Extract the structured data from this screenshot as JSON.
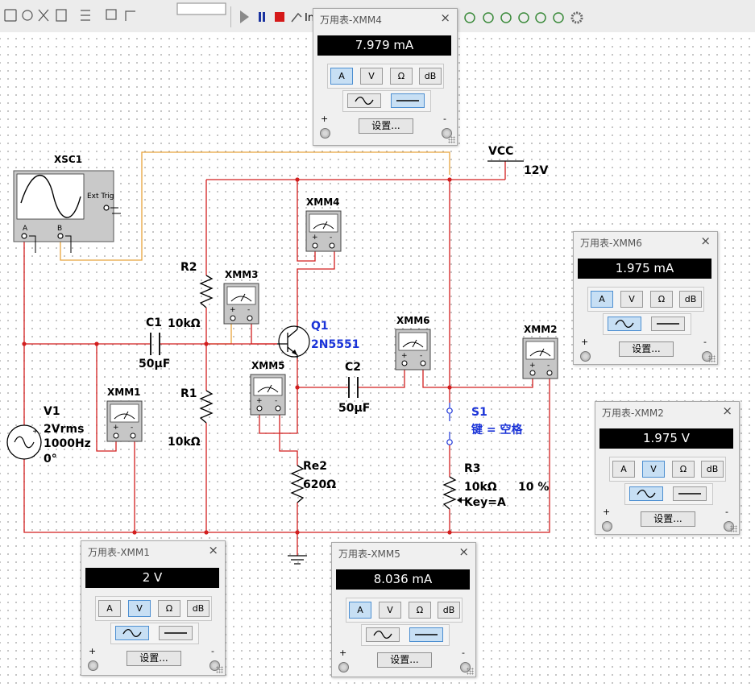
{
  "toolbar": {
    "item_label": "In"
  },
  "components": {
    "vcc": {
      "name": "VCC",
      "value": "12V"
    },
    "oscilloscope": {
      "name": "XSC1",
      "ext_trig": "Ext Trig",
      "ch_a": "A",
      "ch_b": "B"
    },
    "v1": {
      "name": "V1",
      "amplitude": "2Vrms",
      "frequency": "1000Hz",
      "phase": "0°"
    },
    "r1": {
      "name": "R1",
      "value": "10kΩ"
    },
    "r2": {
      "name": "R2",
      "value": "10kΩ"
    },
    "c1": {
      "name": "C1",
      "value": "50µF"
    },
    "c2": {
      "name": "C2",
      "value": "50µF"
    },
    "q1": {
      "name": "Q1",
      "model": "2N5551"
    },
    "re2": {
      "name": "Re2",
      "value": "620Ω"
    },
    "s1": {
      "name": "S1",
      "key": "键 = 空格"
    },
    "r3": {
      "name": "R3",
      "value": "10kΩ",
      "key": "Key=A",
      "percent": "10 %"
    },
    "xmm1": {
      "name": "XMM1"
    },
    "xmm2": {
      "name": "XMM2"
    },
    "xmm3": {
      "name": "XMM3"
    },
    "xmm4": {
      "name": "XMM4"
    },
    "xmm5": {
      "name": "XMM5"
    },
    "xmm6": {
      "name": "XMM6"
    }
  },
  "meter_buttons": {
    "amp": "A",
    "volt": "V",
    "ohm": "Ω",
    "db": "dB",
    "settings": "设置...",
    "plus": "+",
    "minus": "-"
  },
  "panels": {
    "xmm4": {
      "title": "万用表-XMM4",
      "reading": "7.979 mA",
      "mode": "A",
      "wave": "dc"
    },
    "xmm6": {
      "title": "万用表-XMM6",
      "reading": "1.975 mA",
      "mode": "A",
      "wave": "ac"
    },
    "xmm2": {
      "title": "万用表-XMM2",
      "reading": "1.975 V",
      "mode": "V",
      "wave": "ac"
    },
    "xmm1": {
      "title": "万用表-XMM1",
      "reading": "2 V",
      "mode": "V",
      "wave": "ac"
    },
    "xmm5": {
      "title": "万用表-XMM5",
      "reading": "8.036 mA",
      "mode": "A",
      "wave": "dc"
    }
  },
  "colors": {
    "wire_red": "#d21e1e",
    "wire_orange": "#e8a33c",
    "wire_black": "#000000",
    "label_blue": "#1a33d8",
    "display_bg": "#000000",
    "selected_button": "#c7dff4"
  }
}
